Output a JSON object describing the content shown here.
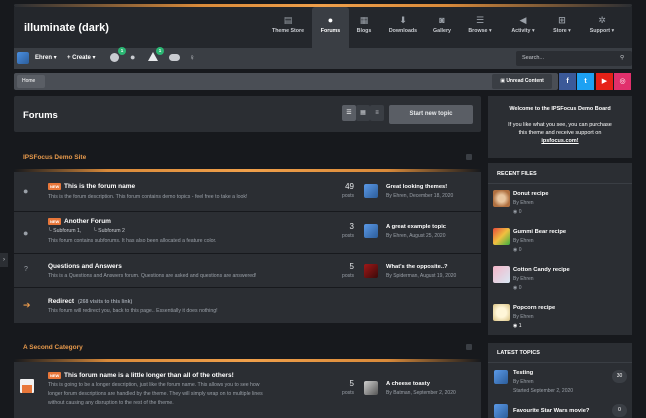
{
  "site": {
    "title": "illuminate (dark)"
  },
  "nav": {
    "tabs": [
      {
        "label": "Theme Store",
        "icon": "document-icon"
      },
      {
        "label": "Forums",
        "icon": "comments-icon"
      },
      {
        "label": "Blogs",
        "icon": "blog-icon"
      },
      {
        "label": "Downloads",
        "icon": "download-icon"
      },
      {
        "label": "Gallery",
        "icon": "camera-icon"
      },
      {
        "label": "Browse",
        "icon": "list-icon"
      },
      {
        "label": "Activity",
        "icon": "megaphone-icon"
      },
      {
        "label": "Store",
        "icon": "cart-icon"
      },
      {
        "label": "Support",
        "icon": "gear-icon"
      }
    ],
    "active": "Forums"
  },
  "userbar": {
    "username": "Ehren",
    "create_label": "Create",
    "notif_badge_1": "1",
    "notif_badge_2": "1",
    "search_placeholder": "Search..."
  },
  "breadcrumb": {
    "home": "Home",
    "unread_label": "Unread Content"
  },
  "social": [
    "f",
    "t",
    "▶",
    "◎"
  ],
  "social_colors": [
    "#3b5998",
    "#1da1f2",
    "#e62117",
    "#e1306c"
  ],
  "forums_header": {
    "title": "Forums",
    "start_label": "Start new topic"
  },
  "categories": [
    {
      "name": "IPSFocus Demo Site",
      "forums": [
        {
          "new": "NEW",
          "name": "This is the forum name",
          "desc": "This is the forum description. This forum contains demo topics - feel free to take a look!",
          "count": "49",
          "count_label": "posts",
          "last_title": "Great looking themes!",
          "last_meta": "By Ehren, December 18, 2020"
        },
        {
          "new": "NEW",
          "name": "Another Forum",
          "subforums": [
            "Subforum 1,",
            "Subforum 2"
          ],
          "desc": "This forum contains subforums. It has also been allocated a feature color.",
          "count": "3",
          "count_label": "posts",
          "last_title": "A great example topic",
          "last_meta": "By Ehren, August 25, 2020"
        },
        {
          "new": "",
          "name": "Questions and Answers",
          "desc": "This is a Questions and Answers forum. Questions are asked and questions are answered!",
          "count": "5",
          "count_label": "posts",
          "last_title": "What's the opposite..?",
          "last_meta": "By Spiderman, August 19, 2020"
        },
        {
          "new": "",
          "name": "Redirect",
          "redirect_note": "(268 visits to this link)",
          "desc": "This forum will redirect you, back to this page.. Essentially it does nothing!",
          "count": "",
          "count_label": "",
          "last_title": "",
          "last_meta": ""
        }
      ]
    },
    {
      "name": "A Second Category",
      "forums": [
        {
          "new": "NEW",
          "name": "This forum name is a little longer than all of the others!",
          "desc_lines": [
            "This is going to be a longer description, just like the forum name. This allows you to see how",
            "longer forum descriptions are handled by the theme. They will simply wrap on to multiple lines",
            "without causing any disruption to the rest of the theme."
          ],
          "count": "5",
          "count_label": "posts",
          "last_title": "A cheese toasty",
          "last_meta": "By Batman, September 2, 2020"
        }
      ]
    }
  ],
  "welcome": {
    "title": "Welcome to the IPSFocus Demo Board",
    "line1": "If you like what you see, you can purchase",
    "line2": "this theme and receive support on",
    "line3": "ipsfocus.com!"
  },
  "recent_files": {
    "title": "RECENT FILES",
    "items": [
      {
        "name": "Donut recipe",
        "by": "By Ehren",
        "count": "0"
      },
      {
        "name": "Gummi Bear recipe",
        "by": "By Ehren",
        "count": "0"
      },
      {
        "name": "Cotton Candy recipe",
        "by": "By Ehren",
        "count": "0"
      },
      {
        "name": "Popcorn recipe",
        "by": "By Ehren",
        "count": "1"
      }
    ]
  },
  "latest_topics": {
    "title": "LATEST TOPICS",
    "items": [
      {
        "name": "Testing",
        "by": "By Ehren",
        "started": "Started September 2, 2020",
        "replies": "30"
      },
      {
        "name": "Favourite Star Wars movie?",
        "by": "",
        "started": "",
        "replies": "0"
      }
    ]
  }
}
